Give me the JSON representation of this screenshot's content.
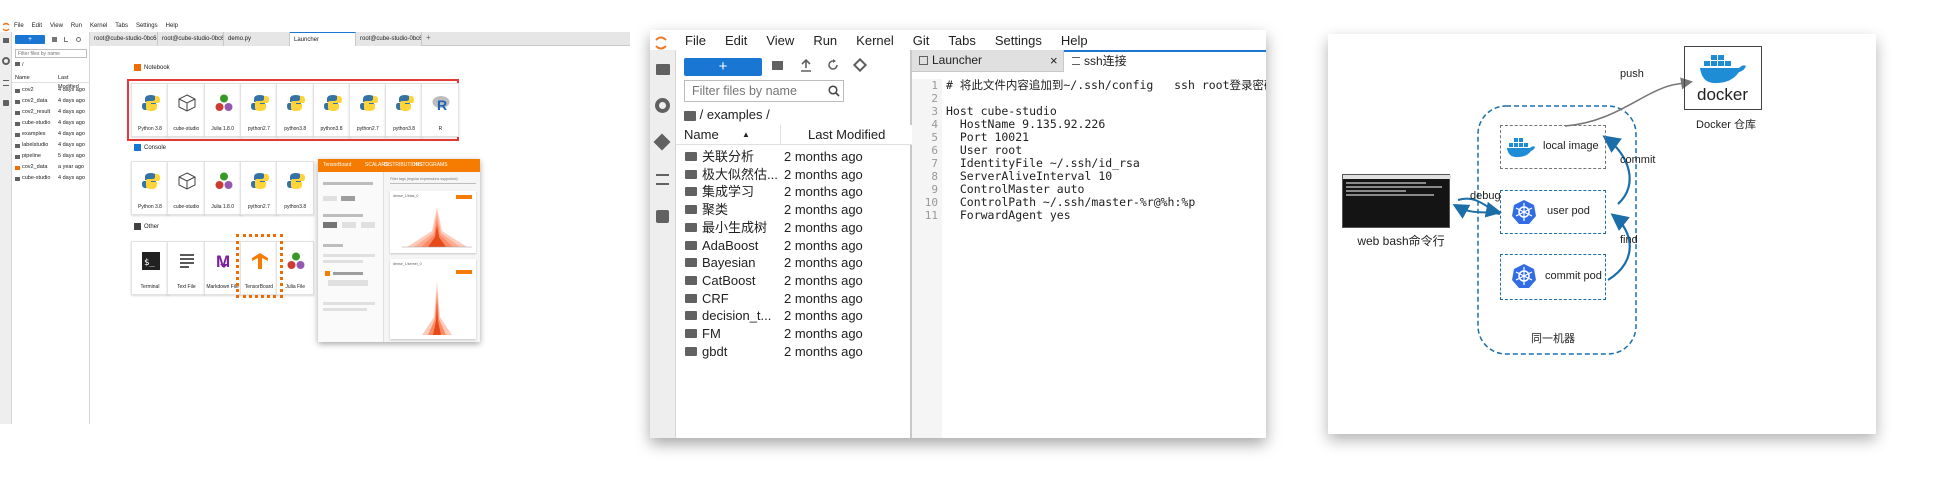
{
  "p1": {
    "menu": [
      "File",
      "Edit",
      "View",
      "Run",
      "Kernel",
      "Tabs",
      "Settings",
      "Help"
    ],
    "tabs": [
      {
        "label": "root@cube-studio-0bc6-7f48f64ffb-ghh6t:/mnt/admin"
      },
      {
        "label": "root@cube-studio-0bc6-7f48f64ffb-ghh6t:/mnt/admin"
      },
      {
        "label": "demo.py"
      },
      {
        "label": "Launcher"
      },
      {
        "label": "root@cube-studio-0bc6-7f48f64ffb-ghh6t:/mnt/admin"
      }
    ],
    "filter": "Filter files by name",
    "path": "/",
    "col_name": "Name",
    "col_modified": "Last Modified",
    "files": [
      {
        "name": "cov2",
        "modified": "4 days ago"
      },
      {
        "name": "cov2_data",
        "modified": "4 days ago"
      },
      {
        "name": "cov2_result",
        "modified": "4 days ago"
      },
      {
        "name": "cube-studio",
        "modified": "4 days ago"
      },
      {
        "name": "examples",
        "modified": "4 days ago"
      },
      {
        "name": "labelstudio",
        "modified": "4 days ago"
      },
      {
        "name": "pipeline",
        "modified": "5 days ago"
      },
      {
        "name": "cov2_data",
        "modified": "a year ago"
      },
      {
        "name": "cube-studio",
        "modified": "4 days ago"
      }
    ],
    "notebook_title": "Notebook",
    "notebook": [
      "Python 3.8",
      "cube-studio",
      "Julia 1.8.0",
      "python2.7",
      "python3.8",
      "python3.8",
      "python2.7",
      "python3.8",
      "R"
    ],
    "console_title": "Console",
    "console": [
      "Python 3.8",
      "cube-studio",
      "Julia 1.8.0",
      "python2.7",
      "python3.8"
    ],
    "other_title": "Other",
    "other": [
      "Terminal",
      "Text File",
      "Markdown File",
      "TensorBoard",
      "Julia File"
    ],
    "tb": {
      "title": "TensorBoard",
      "nav": [
        "SCALARS",
        "DISTRIBUTIONS",
        "HISTOGRAMS"
      ],
      "filter": "Filter tags (regular expressions supported)",
      "charts": [
        "dense_1/bias_0",
        "dense_1/kernel_0"
      ]
    }
  },
  "p2": {
    "menu": [
      "File",
      "Edit",
      "View",
      "Run",
      "Kernel",
      "Git",
      "Tabs",
      "Settings",
      "Help"
    ],
    "new_button": "+",
    "filter": "Filter files by name",
    "path": "/ examples /",
    "col_name": "Name",
    "col_modified": "Last Modified",
    "files": [
      {
        "name": "关联分析",
        "modified": "2 months ago"
      },
      {
        "name": "极大似然估...",
        "modified": "2 months ago"
      },
      {
        "name": "集成学习",
        "modified": "2 months ago"
      },
      {
        "name": "聚类",
        "modified": "2 months ago"
      },
      {
        "name": "最小生成树",
        "modified": "2 months ago"
      },
      {
        "name": "AdaBoost",
        "modified": "2 months ago"
      },
      {
        "name": "Bayesian",
        "modified": "2 months ago"
      },
      {
        "name": "CatBoost",
        "modified": "2 months ago"
      },
      {
        "name": "CRF",
        "modified": "2 months ago"
      },
      {
        "name": "decision_t...",
        "modified": "2 months ago"
      },
      {
        "name": "FM",
        "modified": "2 months ago"
      },
      {
        "name": "gbdt",
        "modified": "2 months ago"
      }
    ],
    "tabs": [
      {
        "label": "Launcher"
      },
      {
        "label": "ssh连接"
      }
    ],
    "code": [
      "# 将此文件内容追加到~/.ssh/config   ssh root登录密码",
      "",
      "Host cube-studio",
      "  HostName 9.135.92.226",
      "  Port 10021",
      "  User root",
      "  IdentityFile ~/.ssh/id_rsa",
      "  ServerAliveInterval 10",
      "  ControlMaster auto",
      "  ControlPath ~/.ssh/master-%r@%h:%p",
      "  ForwardAgent yes"
    ],
    "line_numbers": [
      "1",
      "2",
      "3",
      "4",
      "5",
      "6",
      "7",
      "8",
      "9",
      "10",
      "11"
    ]
  },
  "p3": {
    "push": "push",
    "commit": "commit",
    "find": "find",
    "debug": "debug",
    "docker_logo": "docker",
    "docker_label": "Docker 仓库",
    "local_image": "local image",
    "user_pod": "user pod",
    "commit_pod": "commit pod",
    "web_bash": "web bash命令行",
    "machine": "同一机器"
  },
  "colors": {
    "accent": "#1976d2",
    "selection": "#e53935",
    "highlight": "#ef6c00",
    "tb_orange": "#f57c00",
    "docker_blue": "#1f8cd6",
    "k8s_blue": "#326ce5",
    "diagram_line": "#1b6ea8"
  }
}
